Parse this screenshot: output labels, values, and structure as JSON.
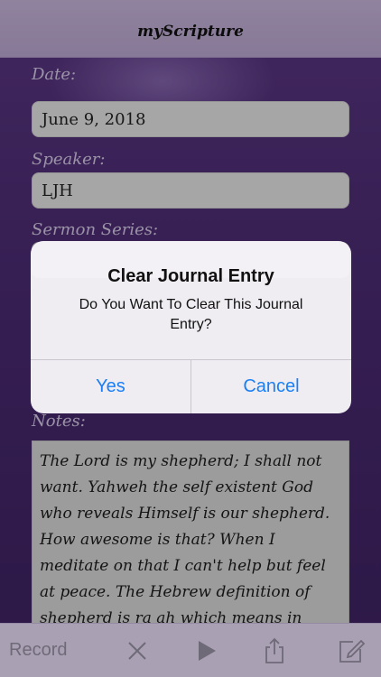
{
  "nav": {
    "title": "myScripture"
  },
  "form": {
    "date_label": "Date:",
    "date_value": "June 9, 2018",
    "speaker_label": "Speaker:",
    "speaker_value": "LJH",
    "series_label": "Sermon Series:",
    "notes_label": "Notes:",
    "notes_text": "The Lord is my shepherd; I shall not want. Yahweh the self existent God who reveals Himself is our shepherd. How awesome is that? When I meditate on that I can't help but feel at peace. The Hebrew definition of shepherd is ra ah which means in addition to leading or guiding is an"
  },
  "alert": {
    "title": "Clear Journal Entry",
    "message": "Do You Want To Clear This Journal Entry?",
    "yes_label": "Yes",
    "cancel_label": "Cancel"
  },
  "toolbar": {
    "record_label": "Record",
    "icons": [
      "close-icon",
      "play-icon",
      "share-icon",
      "compose-icon"
    ]
  },
  "colors": {
    "background": "#4a2a72",
    "nav": "#c8b6dc",
    "accent": "#1a7ff5",
    "toolbar": "#a9a0b4"
  }
}
